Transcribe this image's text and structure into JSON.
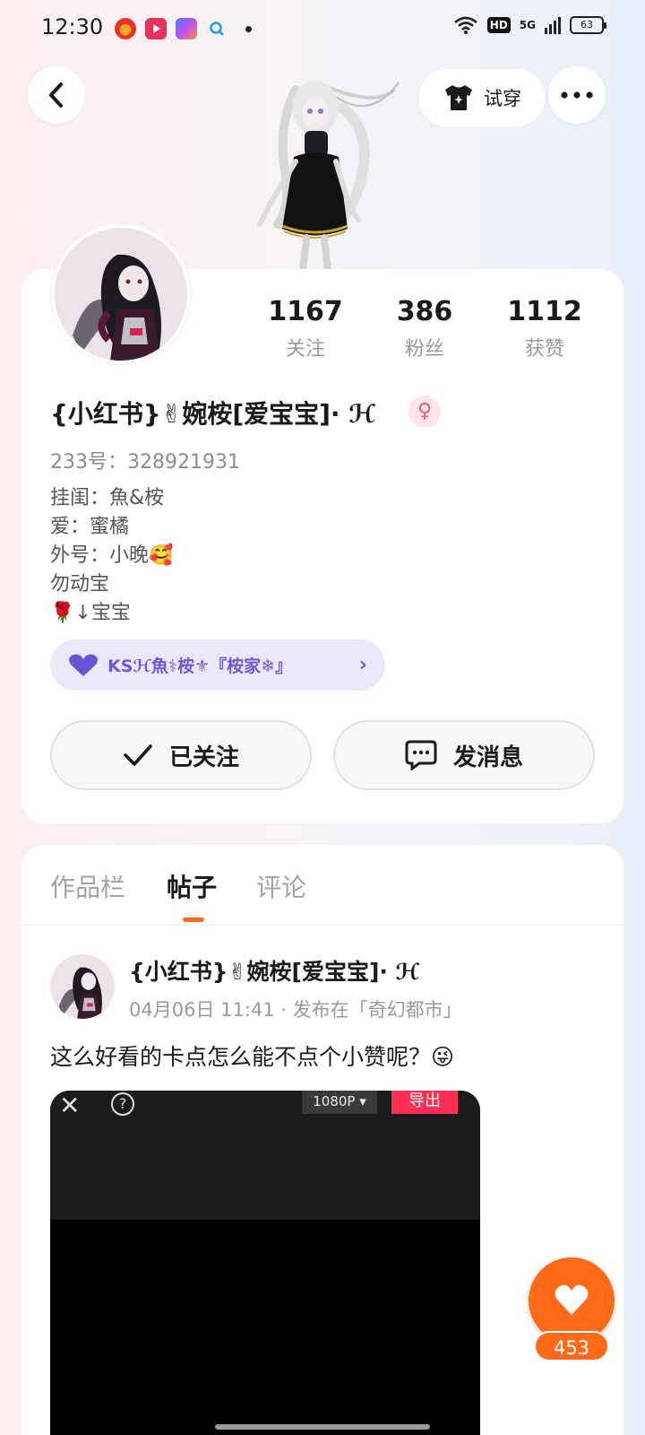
{
  "status_bar": {
    "time": "12:30",
    "hd": "HD",
    "signal": "5G",
    "battery": "63"
  },
  "header": {
    "try_on_label": "试穿"
  },
  "profile": {
    "stats": [
      {
        "value": "1167",
        "label": "关注"
      },
      {
        "value": "386",
        "label": "粉丝"
      },
      {
        "value": "1112",
        "label": "获赞"
      }
    ],
    "name": "{小红书}✌婉桉[爱宝宝]· ℋ",
    "gender_symbol": "♀",
    "uid": "233号：328921931",
    "bio": [
      "挂闺：魚&桉",
      "爱：蜜橘",
      "外号：小晚🥰",
      "勿动宝",
      "🌹↓宝宝"
    ],
    "family_label": "KSℋ魚⚕桉⚜『桉家❄』",
    "follow_label": "已关注",
    "message_label": "发消息"
  },
  "tabs": [
    "作品栏",
    "帖子",
    "评论"
  ],
  "active_tab_index": 1,
  "post": {
    "author": "{小红书}✌婉桉[爱宝宝]· ℋ",
    "meta": "04月06日 11:41 · 发布在「奇幻都市」",
    "text": "这么好看的卡点怎么能不点个小赞呢？😜",
    "video": {
      "resolution": "1080P ▾",
      "export_label": "导出"
    }
  },
  "like": {
    "count": "453"
  },
  "colors": {
    "accent": "#ff6a1a",
    "family_bg": "#ebe8fb",
    "family_text": "#6c5ad8",
    "export": "#ff2c55"
  }
}
